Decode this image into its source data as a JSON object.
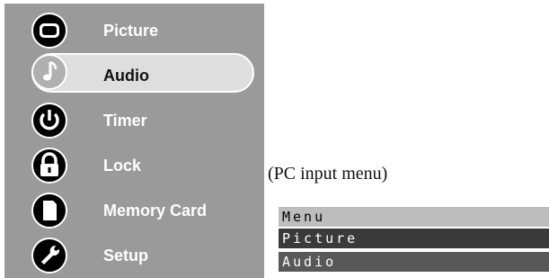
{
  "osd_menu": {
    "items": [
      {
        "label": "Picture",
        "icon": "tv-screen-icon",
        "selected": false
      },
      {
        "label": "Audio",
        "icon": "music-note-icon",
        "selected": true
      },
      {
        "label": "Timer",
        "icon": "power-timer-icon",
        "selected": false
      },
      {
        "label": "Lock",
        "icon": "padlock-icon",
        "selected": false
      },
      {
        "label": "Memory Card",
        "icon": "memory-card-icon",
        "selected": false
      },
      {
        "label": "Setup",
        "icon": "wrench-icon",
        "selected": false
      }
    ]
  },
  "caption": "(PC input menu)",
  "pc_menu": {
    "header": "Menu",
    "items": [
      "Picture",
      "Audio"
    ]
  },
  "colors": {
    "panel": "#9a9a9a",
    "selected_bg": "#dedede",
    "pc_active": "#3a3a3a",
    "pc_item": "#585858",
    "pc_header": "#bdbdbd"
  }
}
